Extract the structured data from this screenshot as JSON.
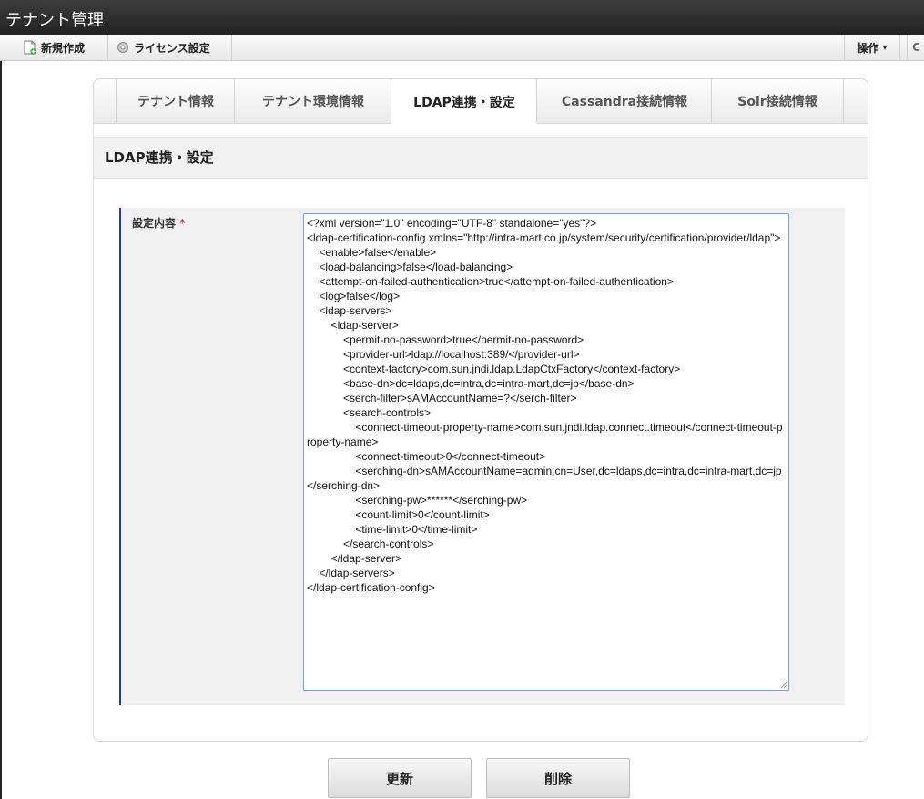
{
  "window": {
    "title": "テナント管理"
  },
  "toolbar": {
    "new_label": "新規作成",
    "license_label": "ライセンス設定",
    "ops_label": "操作",
    "ops_caret": "▾",
    "refresh_glyph": "C"
  },
  "tabs": [
    {
      "label": "テナント情報",
      "active": false
    },
    {
      "label": "テナント環境情報",
      "active": false
    },
    {
      "label": "LDAP連携・設定",
      "active": true
    },
    {
      "label": "Cassandra接続情報",
      "active": false
    },
    {
      "label": "Solr接続情報",
      "active": false
    }
  ],
  "section": {
    "title": "LDAP連携・設定"
  },
  "form": {
    "label": "設定内容",
    "required_mark": "*",
    "value": "<?xml version=\"1.0\" encoding=\"UTF-8\" standalone=\"yes\"?>\n<ldap-certification-config xmlns=\"http://intra-mart.co.jp/system/security/certification/provider/ldap\">\n    <enable>false</enable>\n    <load-balancing>false</load-balancing>\n    <attempt-on-failed-authentication>true</attempt-on-failed-authentication>\n    <log>false</log>\n    <ldap-servers>\n        <ldap-server>\n            <permit-no-password>true</permit-no-password>\n            <provider-url>ldap://localhost:389/</provider-url>\n            <context-factory>com.sun.jndi.ldap.LdapCtxFactory</context-factory>\n            <base-dn>dc=ldaps,dc=intra,dc=intra-mart,dc=jp</base-dn>\n            <serch-filter>sAMAccountName=?</serch-filter>\n            <search-controls>\n                <connect-timeout-property-name>com.sun.jndi.ldap.connect.timeout</connect-timeout-property-name>\n                <connect-timeout>0</connect-timeout>\n                <serching-dn>sAMAccountName=admin,cn=User,dc=ldaps,dc=intra,dc=intra-mart,dc=jp</serching-dn>\n                <serching-pw>******</serching-pw>\n                <count-limit>0</count-limit>\n                <time-limit>0</time-limit>\n            </search-controls>\n        </ldap-server>\n    </ldap-servers>\n</ldap-certification-config>"
  },
  "actions": {
    "update_label": "更新",
    "delete_label": "削除"
  },
  "colors": {
    "accent_bar": "#2a3f8f",
    "required": "#d9534f",
    "textarea_border": "#7fa0d6"
  }
}
